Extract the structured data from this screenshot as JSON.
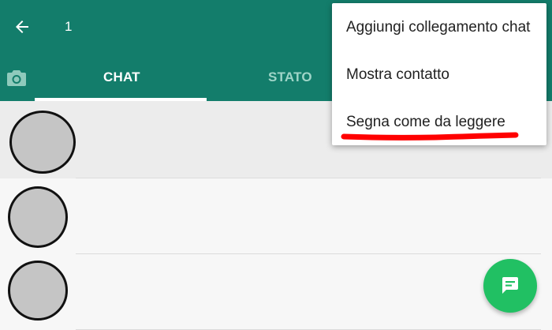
{
  "header": {
    "selected_count": "1",
    "tabs": [
      {
        "label": "CHAT",
        "active": true
      },
      {
        "label": "STATO",
        "active": false
      }
    ],
    "back_icon": "arrow-left-icon",
    "camera_icon": "camera-icon",
    "background_color": "#137d6b"
  },
  "overflow_menu": {
    "items": [
      {
        "label": "Aggiungi collegamento chat"
      },
      {
        "label": "Mostra contatto"
      },
      {
        "label": "Segna come da leggere",
        "highlighted": true
      }
    ],
    "highlight_color": "#ff0000"
  },
  "chats": [
    {
      "selected": true
    },
    {
      "selected": false
    },
    {
      "selected": false
    }
  ],
  "fab": {
    "icon": "message-icon",
    "color": "#21c063"
  }
}
